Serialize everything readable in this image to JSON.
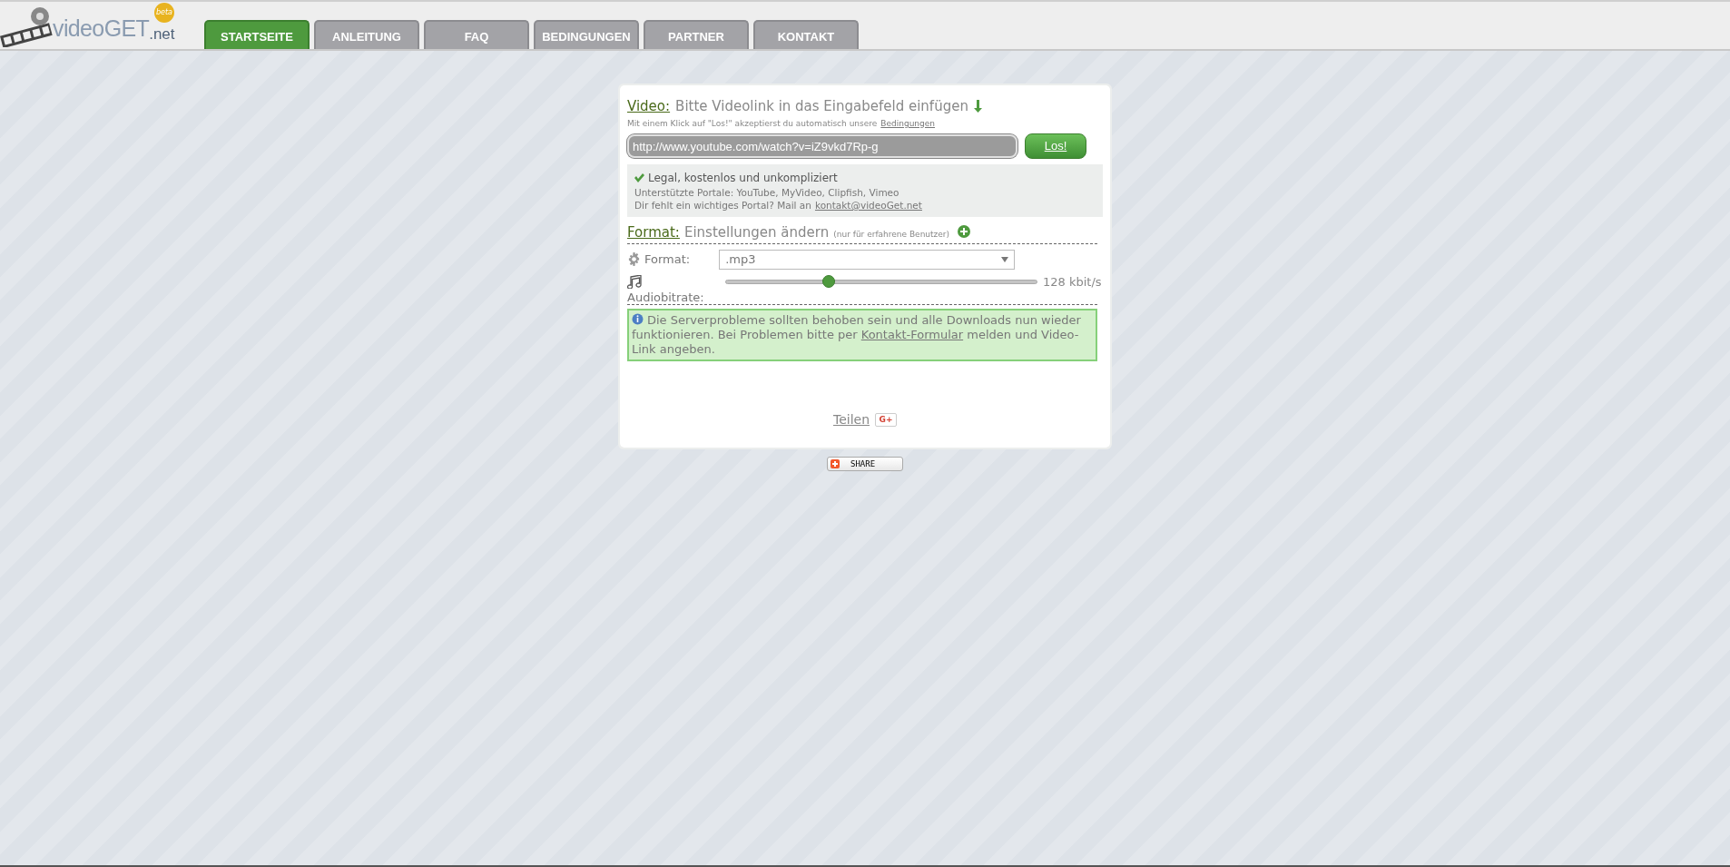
{
  "logo": {
    "name": "videoGET",
    "tld": ".net",
    "badge": "beta"
  },
  "tabs": [
    {
      "label": "STARTSEITE",
      "selected": true
    },
    {
      "label": "ANLEITUNG",
      "selected": false
    },
    {
      "label": "FAQ",
      "selected": false
    },
    {
      "label": "BEDINGUNGEN",
      "selected": false
    },
    {
      "label": "PARTNER",
      "selected": false
    },
    {
      "label": "KONTAKT",
      "selected": false
    }
  ],
  "video": {
    "label": "Video:",
    "heading": "Bitte Videolink in das Eingabefeld einfügen",
    "note": "Mit einem Klick auf \"Los!\" akzeptierst du automatisch unsere",
    "note_link": "Bedingungen",
    "url_value": "http://www.youtube.com/watch?v=iZ9vkd7Rp-g",
    "submit": "Los!"
  },
  "info": {
    "title": "Legal, kostenlos und unkompliziert",
    "line_1": "Unterstützte Portale: YouTube, MyVideo, Clipfish, Vimeo",
    "line_2": "Dir fehlt ein wichtiges Portal? Mail an",
    "email": "kontakt@videoGet.net"
  },
  "format": {
    "label": "Format:",
    "heading": "Einstellungen ändern",
    "hint": "(nur für erfahrene Benutzer)",
    "field_label": "Format:",
    "value": ".mp3",
    "bitrate_label": "Audiobitrate:",
    "bitrate": {
      "level": 0.33,
      "reading": "128 kbit/s"
    }
  },
  "notice": {
    "before": "Die Serverprobleme sollten behoben sein und alle Downloads nun wieder funktionieren. Bei Problemen bitte per",
    "link": "Kontakt-Formular",
    "after": "melden und Video-Link angeben."
  },
  "share": {
    "link": "Teilen",
    "gplus": "G+",
    "button": "SHARE"
  }
}
